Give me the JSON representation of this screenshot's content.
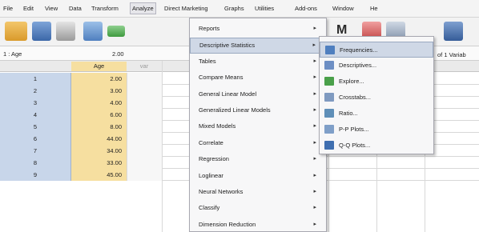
{
  "menubar": {
    "items": [
      {
        "label": "File"
      },
      {
        "label": "Edit"
      },
      {
        "label": "View"
      },
      {
        "label": "Data"
      },
      {
        "label": "Transform"
      },
      {
        "label": "Analyze"
      },
      {
        "label": "Direct Marketing"
      },
      {
        "label": "Graphs"
      },
      {
        "label": "Utilities"
      },
      {
        "label": "Add-ons"
      },
      {
        "label": "Window"
      },
      {
        "label": "He"
      }
    ],
    "active_index": 5
  },
  "cell_editor": {
    "cell_ref": "1 : Age",
    "cell_value": "2.00",
    "variables_count": "of 1 Variab"
  },
  "grid": {
    "columns": [
      "Age",
      "var"
    ],
    "rows": [
      {
        "num": "1",
        "age": "2.00"
      },
      {
        "num": "2",
        "age": "3.00"
      },
      {
        "num": "3",
        "age": "4.00"
      },
      {
        "num": "4",
        "age": "6.00"
      },
      {
        "num": "5",
        "age": "8.00"
      },
      {
        "num": "6",
        "age": "44.00"
      },
      {
        "num": "7",
        "age": "34.00"
      },
      {
        "num": "8",
        "age": "33.00"
      },
      {
        "num": "9",
        "age": "45.00"
      }
    ]
  },
  "analyze_menu": {
    "items": [
      {
        "label": "Reports"
      },
      {
        "label": "Descriptive Statistics"
      },
      {
        "label": "Tables"
      },
      {
        "label": "Compare Means"
      },
      {
        "label": "General Linear Model"
      },
      {
        "label": "Generalized Linear Models"
      },
      {
        "label": "Mixed Models"
      },
      {
        "label": "Correlate"
      },
      {
        "label": "Regression"
      },
      {
        "label": "Loglinear"
      },
      {
        "label": "Neural Networks"
      },
      {
        "label": "Classify"
      },
      {
        "label": "Dimension Reduction"
      }
    ],
    "highlighted_index": 1
  },
  "descriptive_submenu": {
    "items": [
      {
        "label": "Frequencies...",
        "icon": "frequencies-icon"
      },
      {
        "label": "Descriptives...",
        "icon": "descriptives-icon"
      },
      {
        "label": "Explore...",
        "icon": "explore-icon"
      },
      {
        "label": "Crosstabs...",
        "icon": "crosstabs-icon"
      },
      {
        "label": "Ratio...",
        "icon": "ratio-icon"
      },
      {
        "label": "P-P Plots...",
        "icon": "pp-plots-icon"
      },
      {
        "label": "Q-Q Plots...",
        "icon": "qq-plots-icon"
      }
    ],
    "highlighted_index": 0
  },
  "colors": {
    "age_column": "#f6dfa0",
    "row_header": "#c8d6ea",
    "highlight": "#cfd8e6"
  }
}
